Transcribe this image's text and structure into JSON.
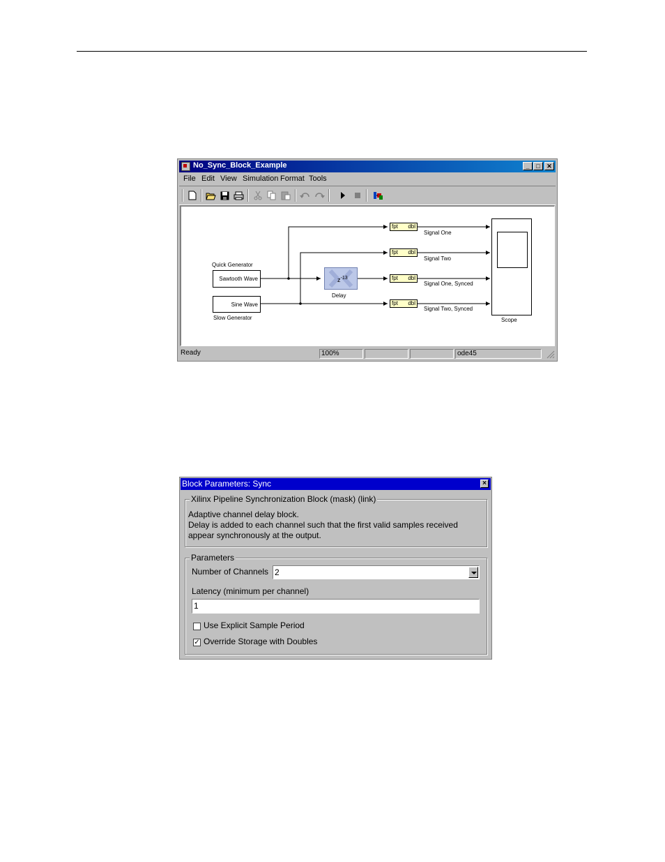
{
  "simulink_window": {
    "title": "No_Sync_Block_Example",
    "menu": [
      "File",
      "Edit",
      "View",
      "Simulation",
      "Format",
      "Tools"
    ],
    "toolbar_icons": [
      "new-icon",
      "open-icon",
      "save-icon",
      "print-icon",
      "cut-icon",
      "copy-icon",
      "paste-icon",
      "undo-icon",
      "redo-icon",
      "play-icon",
      "stop-icon",
      "library-icon"
    ],
    "blocks": {
      "quick_generator_label": "Quick Generator",
      "sawtooth": "Sawtooth Wave",
      "sine": "Sine Wave",
      "slow_generator_label": "Slow Generator",
      "delay_expr": "z",
      "delay_exp": "-13",
      "delay_label": "Delay",
      "converter_in": "fpt",
      "converter_out": "dbl",
      "scope_label": "Scope"
    },
    "signals": [
      "Signal One",
      "Signal Two",
      "Signal One, Synced",
      "Signal Two, Synced"
    ],
    "status": {
      "state": "Ready",
      "zoom": "100%",
      "solver": "ode45"
    }
  },
  "dialog": {
    "title": "Block Parameters: Sync",
    "mask_group_title": "Xilinx Pipeline Synchronization Block (mask) (link)",
    "description": [
      "Adaptive channel delay block.",
      "Delay is added to each channel such that the first valid samples received",
      "appear synchronously at the output."
    ],
    "params_group_title": "Parameters",
    "channels_label": "Number of Channels",
    "channels_value": "2",
    "latency_label": "Latency  (minimum per channel)",
    "latency_value": "1",
    "explicit_period_label": "Use Explicit Sample Period",
    "explicit_period_checked": false,
    "override_label": "Override Storage with Doubles",
    "override_checked": true
  }
}
